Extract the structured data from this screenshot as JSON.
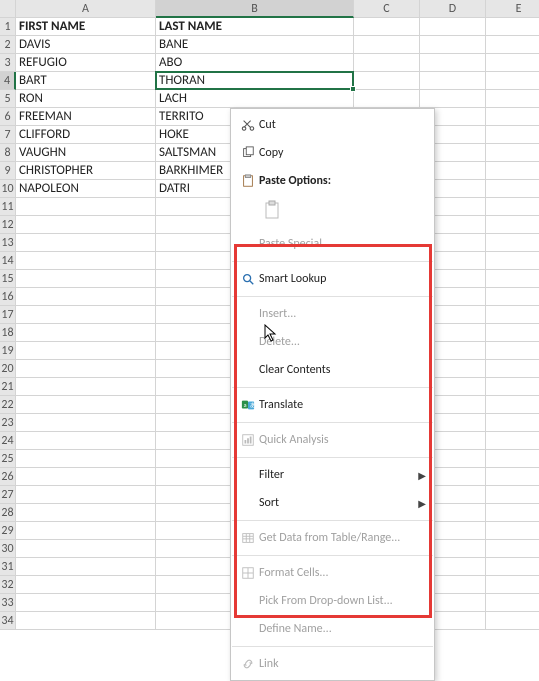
{
  "columns": [
    "A",
    "B",
    "C",
    "D",
    "E"
  ],
  "rowCount": 34,
  "selectedColumnIndex": 1,
  "selectedRowIndex": 3,
  "selectedCell": {
    "col": "B",
    "row": 4
  },
  "headers": {
    "A": "FIRST NAME",
    "B": "LAST NAME"
  },
  "rows": [
    {
      "A": "DAVIS",
      "B": "BANE"
    },
    {
      "A": "REFUGIO",
      "B": "ABO"
    },
    {
      "A": "BART",
      "B": "THORAN"
    },
    {
      "A": "RON",
      "B": "LACH"
    },
    {
      "A": "FREEMAN",
      "B": "TERRITO"
    },
    {
      "A": "CLIFFORD",
      "B": "HOKE"
    },
    {
      "A": "VAUGHN",
      "B": "SALTSMAN"
    },
    {
      "A": "CHRISTOPHER",
      "B": "BARKHIMER"
    },
    {
      "A": "NAPOLEON",
      "B": "DATRI"
    }
  ],
  "contextMenu": {
    "cut": "Cut",
    "copy": "Copy",
    "pasteOptions": "Paste Options:",
    "pasteSpecial": "Paste Special...",
    "smartLookup": "Smart Lookup",
    "insert": "Insert...",
    "delete": "Delete...",
    "clearContents": "Clear Contents",
    "translate": "Translate",
    "quickAnalysis": "Quick Analysis",
    "filter": "Filter",
    "sort": "Sort",
    "getData": "Get Data from Table/Range...",
    "formatCells": "Format Cells...",
    "pickFromList": "Pick From Drop-down List...",
    "defineName": "Define Name...",
    "link": "Link"
  }
}
